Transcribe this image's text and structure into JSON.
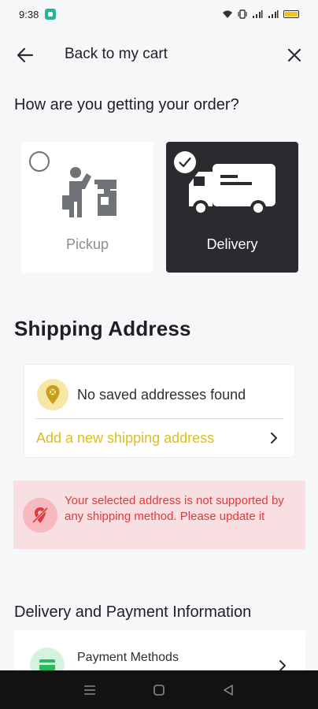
{
  "status_bar": {
    "time": "9:38",
    "icons": [
      "app-notification-icon",
      "wifi-icon",
      "vibrate-icon",
      "signal-icon",
      "signal-icon",
      "battery-icon"
    ]
  },
  "header": {
    "back_icon": "arrow-left-icon",
    "title": "Back to my cart",
    "close_icon": "close-icon"
  },
  "fulfillment": {
    "question": "How are you getting your order?",
    "options": [
      {
        "label": "Pickup",
        "icon": "pickup-person-store-icon",
        "selected": false
      },
      {
        "label": "Delivery",
        "icon": "delivery-truck-icon",
        "selected": true
      }
    ]
  },
  "shipping_address": {
    "title": "Shipping Address",
    "empty_text": "No saved addresses found",
    "add_link": "Add a new shipping address",
    "icon": "location-pin-icon",
    "accent_color": "#e0be1a"
  },
  "alert": {
    "text": "Your selected address is not supported by any shipping method. Please update it",
    "icon": "location-off-icon",
    "color": "#e23a3a",
    "background": "#f8dfe1"
  },
  "delivery_payment": {
    "title": "Delivery and Payment Information",
    "payment_label": "Payment Methods",
    "payment_icon": "payment-card-icon"
  },
  "nav_bar": {
    "buttons": [
      "menu-icon",
      "home-icon",
      "back-triangle-icon"
    ]
  }
}
